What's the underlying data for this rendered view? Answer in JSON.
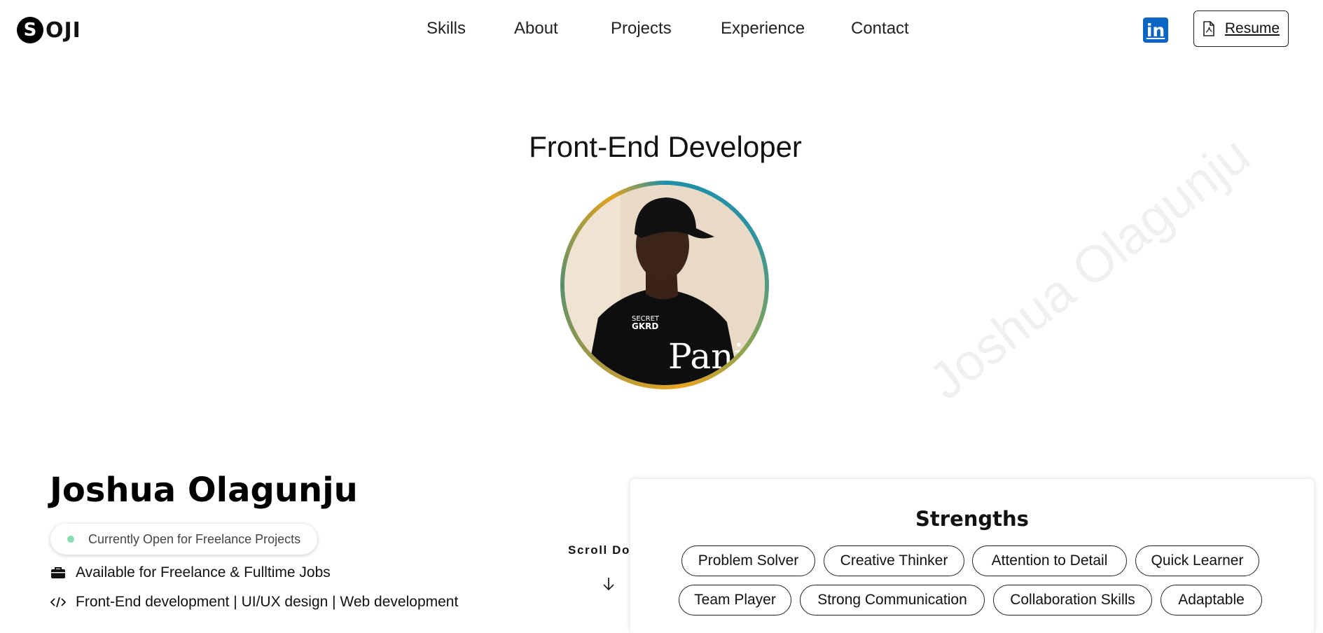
{
  "brand": {
    "logo_letter": "S",
    "logo_text": "OJI"
  },
  "nav": {
    "items": [
      {
        "label": "Skills"
      },
      {
        "label": "About"
      },
      {
        "label": "Projects"
      },
      {
        "label": "Experience"
      },
      {
        "label": "Contact"
      }
    ]
  },
  "header": {
    "linkedin_label": "in",
    "resume_label": "Resume"
  },
  "hero": {
    "role": "Front-End Developer",
    "watermark": "Joshua Olagunju",
    "photo_shirt_text": "Panin"
  },
  "profile": {
    "name": "Joshua Olagunju",
    "status": "Currently Open for Freelance Projects",
    "availability": "Available for Freelance & Fulltime Jobs",
    "specialties": "Front-End development | UI/UX design | Web development",
    "scroll_label": "Scroll Down"
  },
  "strengths": {
    "title": "Strengths",
    "chips": [
      "Problem Solver",
      "Creative Thinker",
      "Attention to Detail",
      "Quick Learner",
      "Team Player",
      "Strong Communication",
      "Collaboration Skills",
      "Adaptable"
    ]
  },
  "colors": {
    "status_dot": "#86dfb2",
    "linkedin": "#0a66c2",
    "ring_teal": "#1c8fa8",
    "ring_gold": "#e7a320"
  }
}
